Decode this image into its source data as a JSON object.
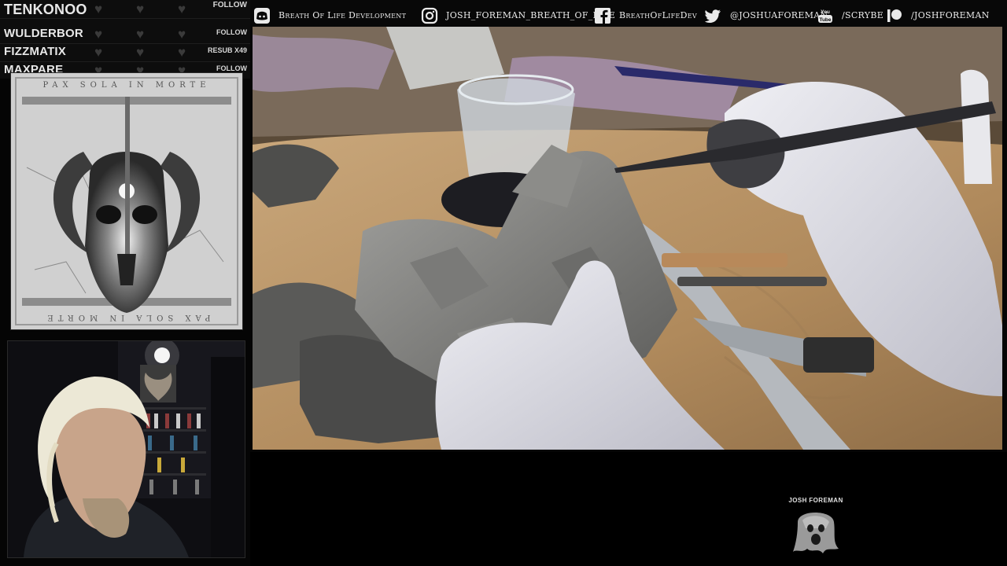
{
  "alerts": [
    {
      "name": "TENKONOO",
      "action": "FOLLOW"
    },
    {
      "name": "WULDERBOR",
      "action": "FOLLOW"
    },
    {
      "name": "FIZZMATIX",
      "action": "RESUB X49"
    },
    {
      "name": "MAXPARE",
      "action": "FOLLOW"
    }
  ],
  "album": {
    "top_text": "PAX SOLA IN MORTE",
    "bottom_text": "PAX SOLA IN MORTE"
  },
  "social": [
    {
      "icon": "discord-icon",
      "label": "Breath Of Life Development"
    },
    {
      "icon": "instagram-icon",
      "label": "JOSH_FOREMAN_BREATH_OF_LIFE"
    },
    {
      "icon": "facebook-icon",
      "label": "BreathOfLifeDev"
    },
    {
      "icon": "twitter-icon",
      "label": "@JOSHUAFOREMAN"
    },
    {
      "icon": "youtube-icon",
      "label": "/SCRYBE"
    },
    {
      "icon": "patreon-icon",
      "label": "/JOSHFOREMAN"
    }
  ],
  "nameplate": {
    "label": "JOSH FOREMAN",
    "icon": "ghost-logo-icon"
  },
  "colors": {
    "background": "#050505",
    "panel": "#0d0d0d",
    "heart": "#3a3a3a",
    "text": "#eaeaea"
  }
}
